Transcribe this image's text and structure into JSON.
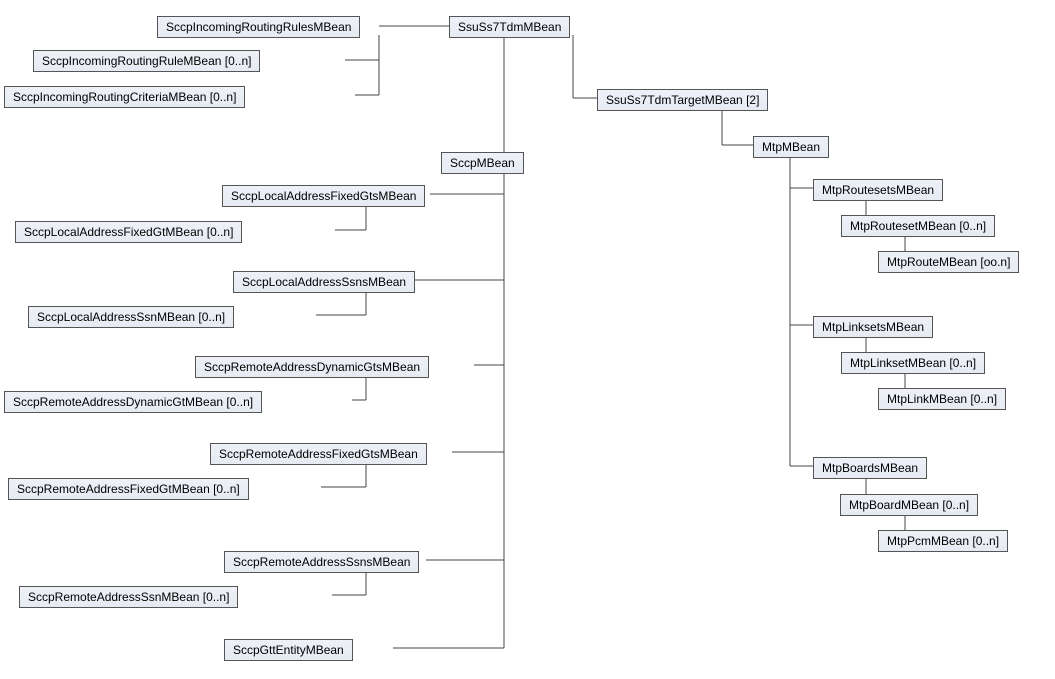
{
  "nodes": {
    "root": "SsuSs7TdmMBean",
    "sccpIncRules": "SccpIncomingRoutingRulesMBean",
    "sccpIncRule": "SccpIncomingRoutingRuleMBean [0..n]",
    "sccpIncCriteria": "SccpIncomingRoutingCriteriaMBean [0..n]",
    "sccp": "SccpMBean",
    "sccpLocalFixedGts": "SccpLocalAddressFixedGtsMBean",
    "sccpLocalFixedGt": "SccpLocalAddressFixedGtMBean [0..n]",
    "sccpLocalSsns": "SccpLocalAddressSsnsMBean",
    "sccpLocalSsn": "SccpLocalAddressSsnMBean [0..n]",
    "sccpRemDynGts": "SccpRemoteAddressDynamicGtsMBean",
    "sccpRemDynGt": "SccpRemoteAddressDynamicGtMBean [0..n]",
    "sccpRemFixGts": "SccpRemoteAddressFixedGtsMBean",
    "sccpRemFixGt": "SccpRemoteAddressFixedGtMBean [0..n]",
    "sccpRemSsns": "SccpRemoteAddressSsnsMBean",
    "sccpRemSsn": "SccpRemoteAddressSsnMBean [0..n]",
    "sccpGtt": "SccpGttEntityMBean",
    "tdmTarget": "SsuSs7TdmTargetMBean [2]",
    "mtp": "MtpMBean",
    "mtpRoutesets": "MtpRoutesetsMBean",
    "mtpRouteset": "MtpRoutesetMBean [0..n]",
    "mtpRoute": "MtpRouteMBean [oo.n]",
    "mtpLinksets": "MtpLinksetsMBean",
    "mtpLinkset": "MtpLinksetMBean [0..n]",
    "mtpLink": "MtpLinkMBean [0..n]",
    "mtpBoards": "MtpBoardsMBean",
    "mtpBoard": "MtpBoardMBean [0..n]",
    "mtpPcm": "MtpPcmMBean [0..n]"
  }
}
